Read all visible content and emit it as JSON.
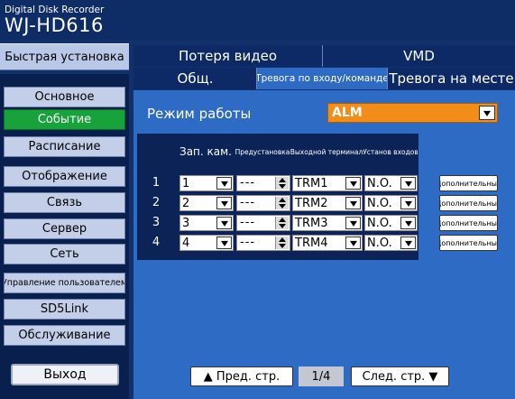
{
  "header": {
    "brand_line1": "Digital Disk Recorder",
    "brand_line2": "WJ-HD616"
  },
  "sidebar": {
    "quick_setup": "Быстрая установка",
    "items": [
      {
        "label": "Основное",
        "active": false
      },
      {
        "label": "Событие",
        "active": true
      },
      {
        "label": "Расписание",
        "active": false
      },
      {
        "label": "Отображение",
        "active": false
      },
      {
        "label": "Связь",
        "active": false
      },
      {
        "label": "Сервер",
        "active": false
      },
      {
        "label": "Сеть",
        "active": false
      },
      {
        "label": "Управление пользователем",
        "active": false
      },
      {
        "label": "SD5Link",
        "active": false
      },
      {
        "label": "Обслуживание",
        "active": false
      }
    ],
    "exit": "Выход"
  },
  "tabs": {
    "row1": [
      "Потеря видео",
      "VMD"
    ],
    "row2": [
      "Общ.",
      "Тревога по входу/команде",
      "Тревога на месте"
    ],
    "selected": "Тревога по входу/команде"
  },
  "mode": {
    "label": "Режим работы",
    "value": "ALM"
  },
  "table": {
    "headers": [
      "Зап. кам.",
      "Предустановка",
      "Выходной терминал",
      "Установ входов"
    ],
    "rows": [
      {
        "num": "1",
        "camera": "1",
        "preset": "---",
        "terminal": "TRM1",
        "input": "N.O.",
        "extra": "Дополнительные"
      },
      {
        "num": "2",
        "camera": "2",
        "preset": "---",
        "terminal": "TRM2",
        "input": "N.O.",
        "extra": "Дополнительные"
      },
      {
        "num": "3",
        "camera": "3",
        "preset": "---",
        "terminal": "TRM3",
        "input": "N.O.",
        "extra": "Дополнительные"
      },
      {
        "num": "4",
        "camera": "4",
        "preset": "---",
        "terminal": "TRM4",
        "input": "N.O.",
        "extra": "Дополнительные"
      }
    ]
  },
  "pager": {
    "prev": "▲ Пред. стр.",
    "page": "1/4",
    "next": "След. стр. ▼"
  },
  "colors": {
    "background": "#12306a",
    "active_item": "#18a23c",
    "selected_tab": "#2d6bc4",
    "mode_select": "#f28d1a"
  }
}
